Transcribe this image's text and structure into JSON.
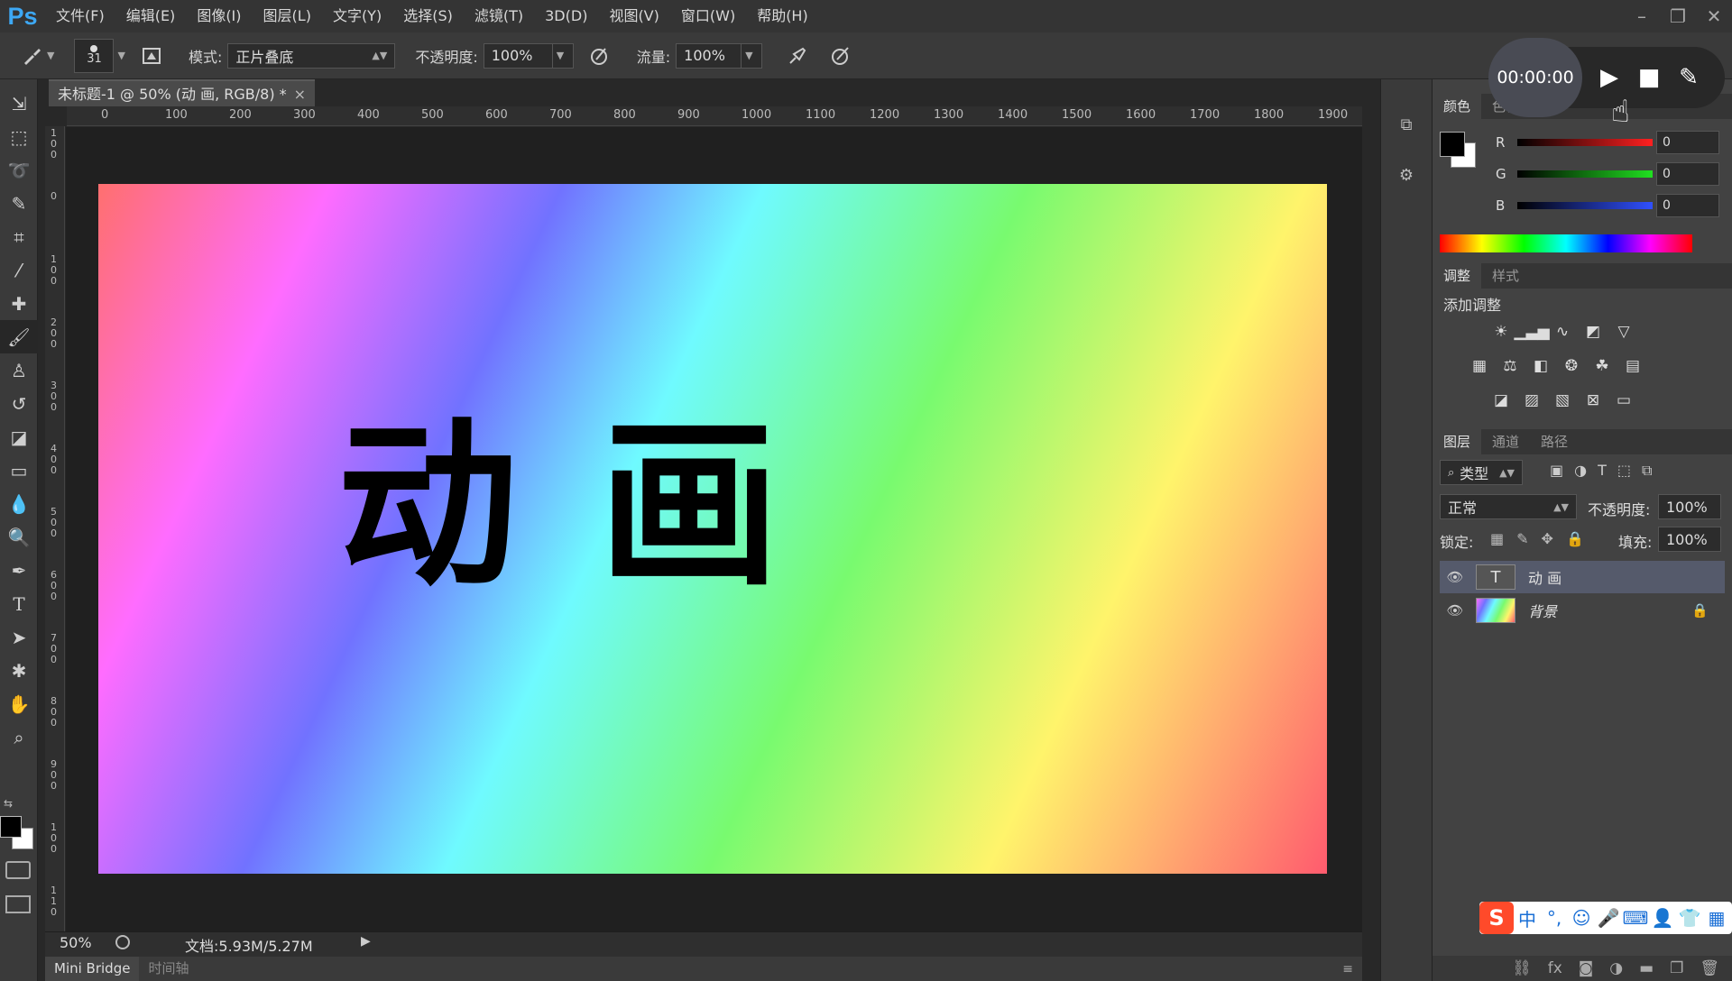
{
  "app": {
    "logo": "Ps"
  },
  "menu": [
    "文件(F)",
    "编辑(E)",
    "图像(I)",
    "图层(L)",
    "文字(Y)",
    "选择(S)",
    "滤镜(T)",
    "3D(D)",
    "视图(V)",
    "窗口(W)",
    "帮助(H)"
  ],
  "options": {
    "brush_size": "31",
    "mode_label": "模式:",
    "mode_value": "正片叠底",
    "opacity_label": "不透明度:",
    "opacity_value": "100%",
    "flow_label": "流量:",
    "flow_value": "100%"
  },
  "document": {
    "tab_title": "未标题-1 @ 50% (动 画, RGB/8) *",
    "canvas_text": "动画",
    "ruler_top": [
      "0",
      "100",
      "200",
      "300",
      "400",
      "500",
      "600",
      "700",
      "800",
      "900",
      "1000",
      "1100",
      "1200",
      "1300",
      "1400",
      "1500",
      "1600",
      "1700",
      "1800",
      "1900"
    ],
    "ruler_left": [
      "1\n0\n0",
      "0",
      "1\n0\n0",
      "2\n0\n0",
      "3\n0\n0",
      "4\n0\n0",
      "5\n0\n0",
      "6\n0\n0",
      "7\n0\n0",
      "8\n0\n0",
      "9\n0\n0",
      "1\n0\n0",
      "1\n1\n0"
    ]
  },
  "status": {
    "zoom": "50%",
    "doc_info": "文档:5.93M/5.27M"
  },
  "bottom_tabs": [
    "Mini Bridge",
    "时间轴"
  ],
  "recorder": {
    "time": "00:00:00"
  },
  "color_panel": {
    "tabs": [
      "颜色",
      "色板"
    ],
    "channels": [
      {
        "name": "R",
        "value": "0",
        "color": "#e03030"
      },
      {
        "name": "G",
        "value": "0",
        "color": "#30c030"
      },
      {
        "name": "B",
        "value": "0",
        "color": "#3050e0"
      }
    ]
  },
  "adjust_panel": {
    "tabs": [
      "调整",
      "样式"
    ],
    "title": "添加调整"
  },
  "layers_panel": {
    "tabs": [
      "图层",
      "通道",
      "路径"
    ],
    "filter": "类型",
    "blend": "正常",
    "opacity_label": "不透明度:",
    "opacity": "100%",
    "lock_label": "锁定:",
    "fill_label": "填充:",
    "fill": "100%",
    "layers": [
      {
        "name": "动 画",
        "thumb": "T"
      },
      {
        "name": "背景",
        "thumb": ""
      }
    ]
  },
  "ime": {
    "lang": "中"
  }
}
